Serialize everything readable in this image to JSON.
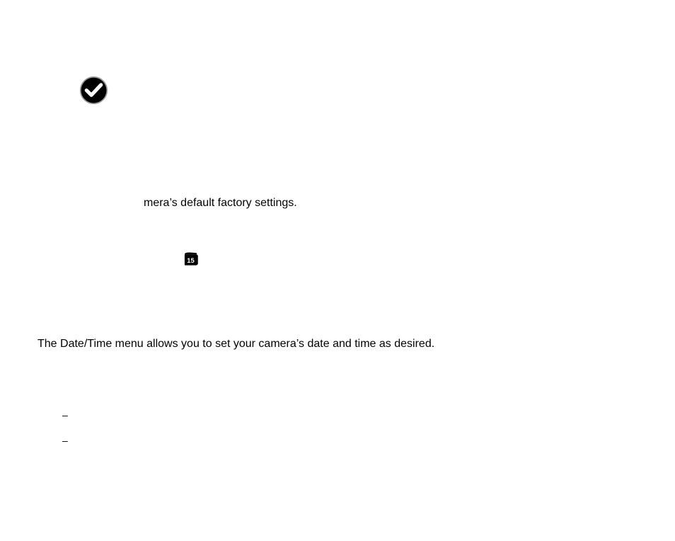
{
  "icons": {
    "checkmark": "checkmark-in-circle-icon",
    "calendar": "calendar-15-icon"
  },
  "text": {
    "factory_fragment": "mera’s default factory settings.",
    "datetime_body": "The Date/Time menu allows you to set your camera’s date and time as desired.",
    "dash": "–"
  }
}
